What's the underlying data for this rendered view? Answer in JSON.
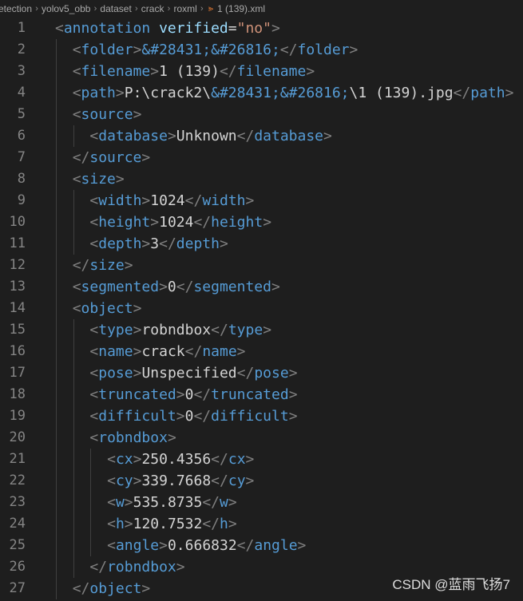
{
  "breadcrumb": {
    "items": [
      "etection",
      "yolov5_obb",
      "dataset",
      "crack",
      "roxml",
      "1 (139).xml"
    ],
    "icon": "rss-icon"
  },
  "editor": {
    "lines": [
      {
        "n": "1",
        "indent": 0,
        "tokens": [
          [
            "b",
            "<"
          ],
          [
            "n",
            "annotation"
          ],
          [
            "x",
            " "
          ],
          [
            "a",
            "verified"
          ],
          [
            "x",
            "="
          ],
          [
            "s",
            "\"no\""
          ],
          [
            "b",
            ">"
          ]
        ]
      },
      {
        "n": "2",
        "indent": 1,
        "tokens": [
          [
            "b",
            "<"
          ],
          [
            "n",
            "folder"
          ],
          [
            "b",
            ">"
          ],
          [
            "e",
            "&#28431;&#26816;"
          ],
          [
            "b",
            "</"
          ],
          [
            "n",
            "folder"
          ],
          [
            "b",
            ">"
          ]
        ]
      },
      {
        "n": "3",
        "indent": 1,
        "tokens": [
          [
            "b",
            "<"
          ],
          [
            "n",
            "filename"
          ],
          [
            "b",
            ">"
          ],
          [
            "x",
            "1 (139)"
          ],
          [
            "b",
            "</"
          ],
          [
            "n",
            "filename"
          ],
          [
            "b",
            ">"
          ]
        ]
      },
      {
        "n": "4",
        "indent": 1,
        "tokens": [
          [
            "b",
            "<"
          ],
          [
            "n",
            "path"
          ],
          [
            "b",
            ">"
          ],
          [
            "x",
            "P:\\crack2\\"
          ],
          [
            "e",
            "&#28431;&#26816;"
          ],
          [
            "x",
            "\\1 (139).jpg"
          ],
          [
            "b",
            "</"
          ],
          [
            "n",
            "path"
          ],
          [
            "b",
            ">"
          ]
        ]
      },
      {
        "n": "5",
        "indent": 1,
        "tokens": [
          [
            "b",
            "<"
          ],
          [
            "n",
            "source"
          ],
          [
            "b",
            ">"
          ]
        ]
      },
      {
        "n": "6",
        "indent": 2,
        "tokens": [
          [
            "b",
            "<"
          ],
          [
            "n",
            "database"
          ],
          [
            "b",
            ">"
          ],
          [
            "x",
            "Unknown"
          ],
          [
            "b",
            "</"
          ],
          [
            "n",
            "database"
          ],
          [
            "b",
            ">"
          ]
        ]
      },
      {
        "n": "7",
        "indent": 1,
        "tokens": [
          [
            "b",
            "</"
          ],
          [
            "n",
            "source"
          ],
          [
            "b",
            ">"
          ]
        ]
      },
      {
        "n": "8",
        "indent": 1,
        "tokens": [
          [
            "b",
            "<"
          ],
          [
            "n",
            "size"
          ],
          [
            "b",
            ">"
          ]
        ]
      },
      {
        "n": "9",
        "indent": 2,
        "tokens": [
          [
            "b",
            "<"
          ],
          [
            "n",
            "width"
          ],
          [
            "b",
            ">"
          ],
          [
            "x",
            "1024"
          ],
          [
            "b",
            "</"
          ],
          [
            "n",
            "width"
          ],
          [
            "b",
            ">"
          ]
        ]
      },
      {
        "n": "10",
        "indent": 2,
        "tokens": [
          [
            "b",
            "<"
          ],
          [
            "n",
            "height"
          ],
          [
            "b",
            ">"
          ],
          [
            "x",
            "1024"
          ],
          [
            "b",
            "</"
          ],
          [
            "n",
            "height"
          ],
          [
            "b",
            ">"
          ]
        ]
      },
      {
        "n": "11",
        "indent": 2,
        "tokens": [
          [
            "b",
            "<"
          ],
          [
            "n",
            "depth"
          ],
          [
            "b",
            ">"
          ],
          [
            "x",
            "3"
          ],
          [
            "b",
            "</"
          ],
          [
            "n",
            "depth"
          ],
          [
            "b",
            ">"
          ]
        ]
      },
      {
        "n": "12",
        "indent": 1,
        "tokens": [
          [
            "b",
            "</"
          ],
          [
            "n",
            "size"
          ],
          [
            "b",
            ">"
          ]
        ]
      },
      {
        "n": "13",
        "indent": 1,
        "tokens": [
          [
            "b",
            "<"
          ],
          [
            "n",
            "segmented"
          ],
          [
            "b",
            ">"
          ],
          [
            "x",
            "0"
          ],
          [
            "b",
            "</"
          ],
          [
            "n",
            "segmented"
          ],
          [
            "b",
            ">"
          ]
        ]
      },
      {
        "n": "14",
        "indent": 1,
        "tokens": [
          [
            "b",
            "<"
          ],
          [
            "n",
            "object"
          ],
          [
            "b",
            ">"
          ]
        ]
      },
      {
        "n": "15",
        "indent": 2,
        "tokens": [
          [
            "b",
            "<"
          ],
          [
            "n",
            "type"
          ],
          [
            "b",
            ">"
          ],
          [
            "x",
            "robndbox"
          ],
          [
            "b",
            "</"
          ],
          [
            "n",
            "type"
          ],
          [
            "b",
            ">"
          ]
        ]
      },
      {
        "n": "16",
        "indent": 2,
        "tokens": [
          [
            "b",
            "<"
          ],
          [
            "n",
            "name"
          ],
          [
            "b",
            ">"
          ],
          [
            "x",
            "crack"
          ],
          [
            "b",
            "</"
          ],
          [
            "n",
            "name"
          ],
          [
            "b",
            ">"
          ]
        ]
      },
      {
        "n": "17",
        "indent": 2,
        "tokens": [
          [
            "b",
            "<"
          ],
          [
            "n",
            "pose"
          ],
          [
            "b",
            ">"
          ],
          [
            "x",
            "Unspecified"
          ],
          [
            "b",
            "</"
          ],
          [
            "n",
            "pose"
          ],
          [
            "b",
            ">"
          ]
        ]
      },
      {
        "n": "18",
        "indent": 2,
        "tokens": [
          [
            "b",
            "<"
          ],
          [
            "n",
            "truncated"
          ],
          [
            "b",
            ">"
          ],
          [
            "x",
            "0"
          ],
          [
            "b",
            "</"
          ],
          [
            "n",
            "truncated"
          ],
          [
            "b",
            ">"
          ]
        ]
      },
      {
        "n": "19",
        "indent": 2,
        "tokens": [
          [
            "b",
            "<"
          ],
          [
            "n",
            "difficult"
          ],
          [
            "b",
            ">"
          ],
          [
            "x",
            "0"
          ],
          [
            "b",
            "</"
          ],
          [
            "n",
            "difficult"
          ],
          [
            "b",
            ">"
          ]
        ]
      },
      {
        "n": "20",
        "indent": 2,
        "tokens": [
          [
            "b",
            "<"
          ],
          [
            "n",
            "robndbox"
          ],
          [
            "b",
            ">"
          ]
        ]
      },
      {
        "n": "21",
        "indent": 3,
        "tokens": [
          [
            "b",
            "<"
          ],
          [
            "n",
            "cx"
          ],
          [
            "b",
            ">"
          ],
          [
            "x",
            "250.4356"
          ],
          [
            "b",
            "</"
          ],
          [
            "n",
            "cx"
          ],
          [
            "b",
            ">"
          ]
        ]
      },
      {
        "n": "22",
        "indent": 3,
        "tokens": [
          [
            "b",
            "<"
          ],
          [
            "n",
            "cy"
          ],
          [
            "b",
            ">"
          ],
          [
            "x",
            "339.7668"
          ],
          [
            "b",
            "</"
          ],
          [
            "n",
            "cy"
          ],
          [
            "b",
            ">"
          ]
        ]
      },
      {
        "n": "23",
        "indent": 3,
        "tokens": [
          [
            "b",
            "<"
          ],
          [
            "n",
            "w"
          ],
          [
            "b",
            ">"
          ],
          [
            "x",
            "535.8735"
          ],
          [
            "b",
            "</"
          ],
          [
            "n",
            "w"
          ],
          [
            "b",
            ">"
          ]
        ]
      },
      {
        "n": "24",
        "indent": 3,
        "tokens": [
          [
            "b",
            "<"
          ],
          [
            "n",
            "h"
          ],
          [
            "b",
            ">"
          ],
          [
            "x",
            "120.7532"
          ],
          [
            "b",
            "</"
          ],
          [
            "n",
            "h"
          ],
          [
            "b",
            ">"
          ]
        ]
      },
      {
        "n": "25",
        "indent": 3,
        "tokens": [
          [
            "b",
            "<"
          ],
          [
            "n",
            "angle"
          ],
          [
            "b",
            ">"
          ],
          [
            "x",
            "0.666832"
          ],
          [
            "b",
            "</"
          ],
          [
            "n",
            "angle"
          ],
          [
            "b",
            ">"
          ]
        ]
      },
      {
        "n": "26",
        "indent": 2,
        "tokens": [
          [
            "b",
            "</"
          ],
          [
            "n",
            "robndbox"
          ],
          [
            "b",
            ">"
          ]
        ]
      },
      {
        "n": "27",
        "indent": 1,
        "tokens": [
          [
            "b",
            "</"
          ],
          [
            "n",
            "object"
          ],
          [
            "b",
            ">"
          ]
        ]
      }
    ]
  },
  "watermark": "CSDN @蓝雨飞扬7",
  "colors": {
    "background": "#1e1e1e",
    "bracket": "#808080",
    "tag": "#569cd6",
    "attribute": "#9cdcfe",
    "string": "#ce9178",
    "text": "#d4d4d4",
    "line_number": "#858585",
    "file_icon": "#e37933"
  }
}
